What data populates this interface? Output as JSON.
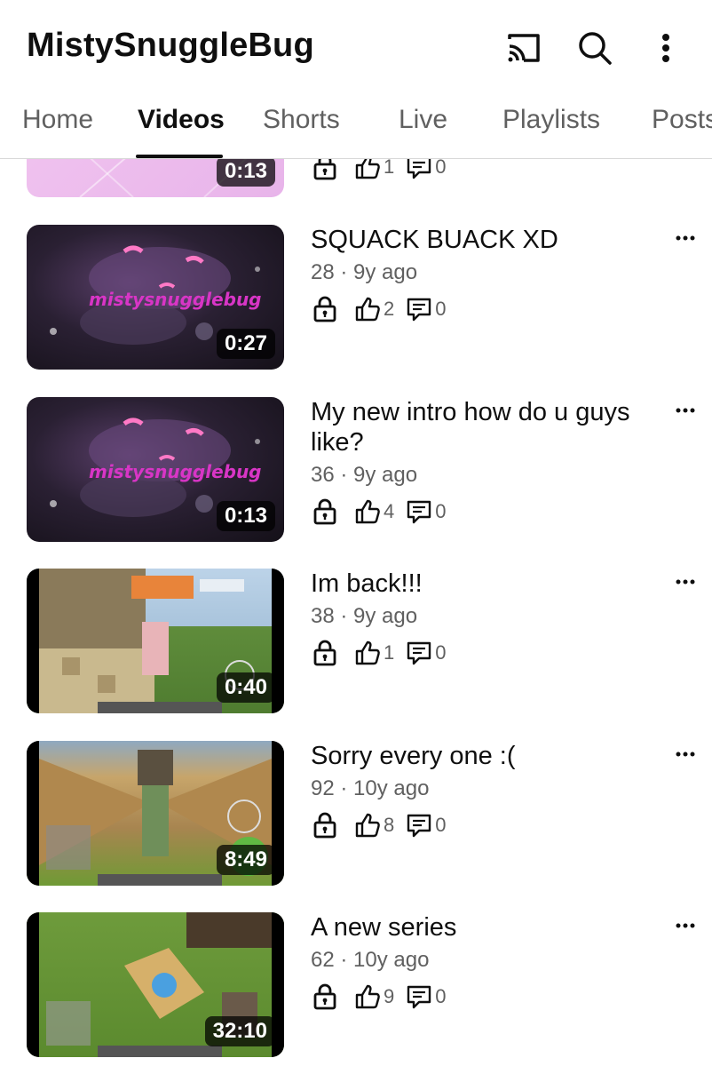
{
  "header": {
    "channel_name": "MistySnuggleBug",
    "icons": [
      "cast-icon",
      "search-icon",
      "more-vert-icon"
    ]
  },
  "tabs": [
    {
      "label": "Home"
    },
    {
      "label": "Videos",
      "active": true
    },
    {
      "label": "Shorts"
    },
    {
      "label": "Live"
    },
    {
      "label": "Playlists"
    },
    {
      "label": "Posts"
    }
  ],
  "partial_video": {
    "duration": "0:13",
    "likes": "1",
    "comments": "0"
  },
  "videos": [
    {
      "title": "SQUACK BUACK XD",
      "meta": "28 · 9y ago",
      "likes": "2",
      "comments": "0",
      "duration": "0:27",
      "thumb_text": "mistysnugglebug"
    },
    {
      "title": "My new intro how do u guys like?",
      "meta": "36 · 9y ago",
      "likes": "4",
      "comments": "0",
      "duration": "0:13",
      "thumb_text": "mistysnugglebug"
    },
    {
      "title": "Im back!!!",
      "meta": "38 · 9y ago",
      "likes": "1",
      "comments": "0",
      "duration": "0:40"
    },
    {
      "title": "Sorry every one :(",
      "meta": "92 · 10y ago",
      "likes": "8",
      "comments": "0",
      "duration": "8:49"
    },
    {
      "title": "A new series",
      "meta": "62 · 10y ago",
      "likes": "9",
      "comments": "0",
      "duration": "32:10"
    }
  ],
  "colors": {
    "text": "#0f0f0f",
    "secondary": "#606060",
    "background": "#ffffff"
  }
}
